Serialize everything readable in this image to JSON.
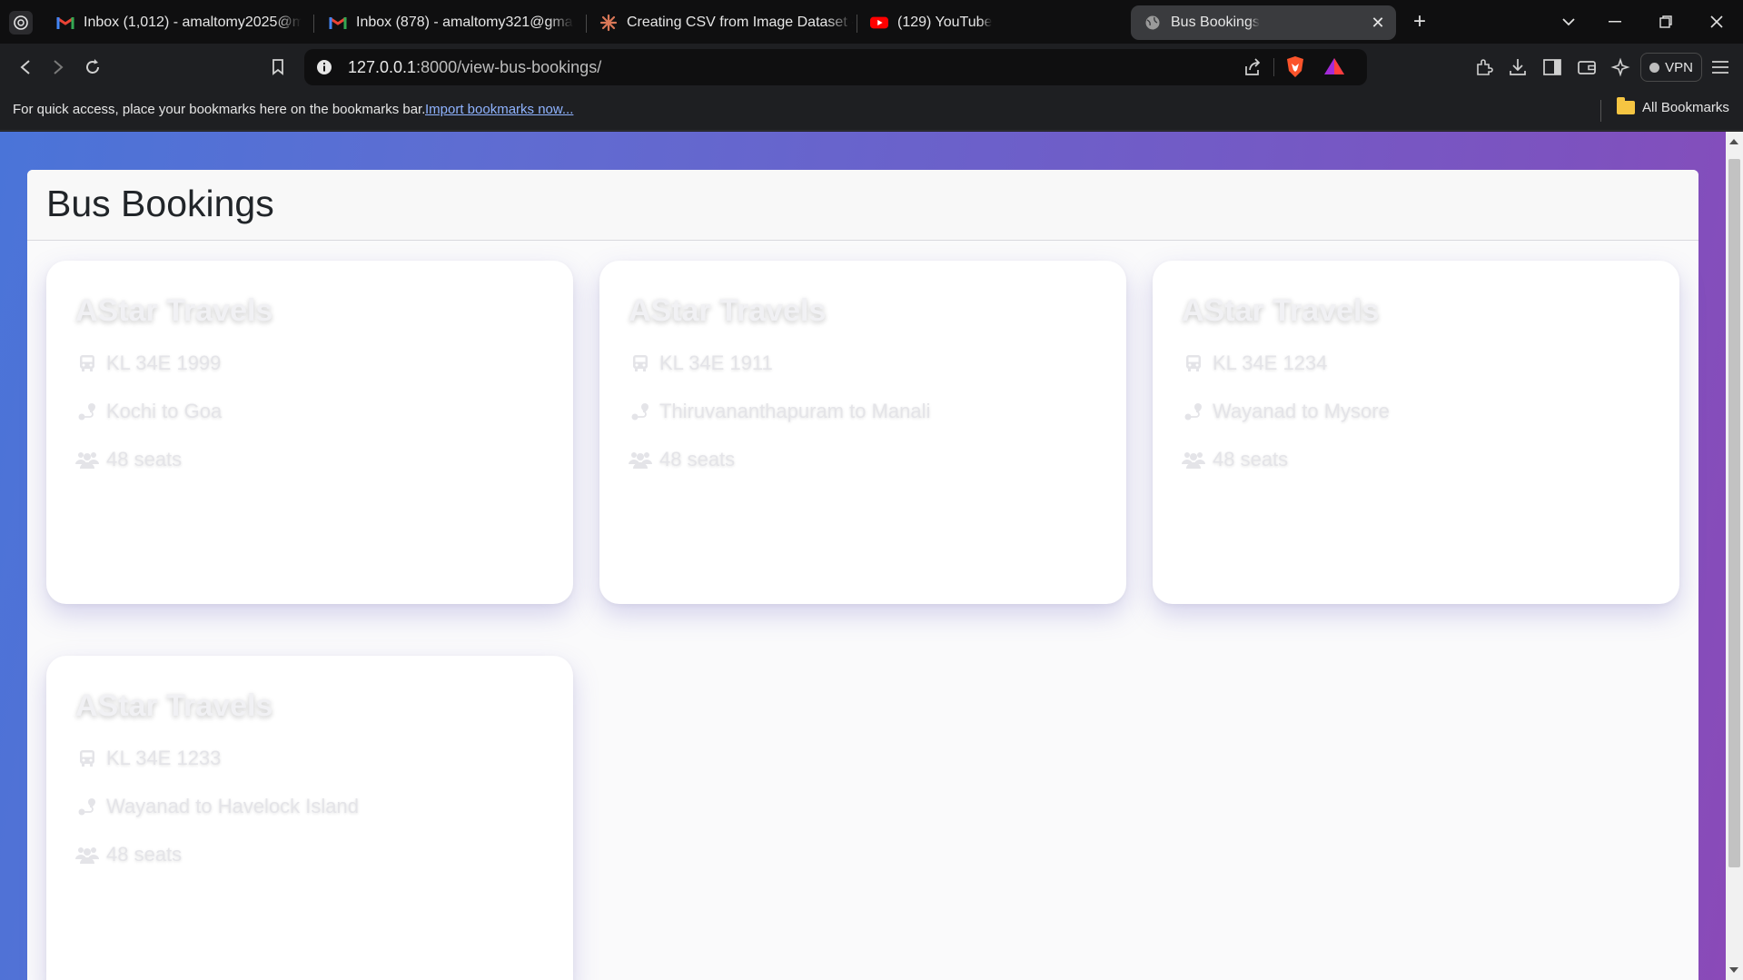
{
  "browser": {
    "tabs": [
      {
        "title": "Inbox (1,012) - amaltomy2025@mca",
        "favicon": "gmail-icon"
      },
      {
        "title": "Inbox (878) - amaltomy321@gmail.c",
        "favicon": "gmail-icon"
      },
      {
        "title": "Creating CSV from Image Dataset - C",
        "favicon": "claude-icon"
      },
      {
        "title": "(129) YouTube",
        "favicon": "youtube-icon"
      },
      {
        "title": "Bus Bookings",
        "favicon": "globe-icon",
        "active": true
      }
    ],
    "address": {
      "host": "127.0.0.1",
      "path": ":8000/view-bus-bookings/"
    },
    "vpn_label": "VPN",
    "bookmarks_bar": {
      "hint": "For quick access, place your bookmarks here on the bookmarks bar.",
      "import_link": "Import bookmarks now...",
      "all_bookmarks": "All Bookmarks"
    }
  },
  "page": {
    "title": "Bus Bookings",
    "bookings": [
      {
        "operator": "AStar Travels",
        "bus_number": "KL 34E 1999",
        "route": "Kochi to Goa",
        "seats": "48 seats"
      },
      {
        "operator": "AStar Travels",
        "bus_number": "KL 34E 1911",
        "route": "Thiruvananthapuram to Manali",
        "seats": "48 seats"
      },
      {
        "operator": "AStar Travels",
        "bus_number": "KL 34E 1234",
        "route": "Wayanad to Mysore",
        "seats": "48 seats"
      },
      {
        "operator": "AStar Travels",
        "bus_number": "KL 34E 1233",
        "route": "Wayanad to Havelock Island",
        "seats": "48 seats"
      }
    ]
  },
  "colors": {
    "gradient_start": "#4a74d8",
    "gradient_end": "#8a4ab8",
    "card_text": "#e4e4e8"
  }
}
